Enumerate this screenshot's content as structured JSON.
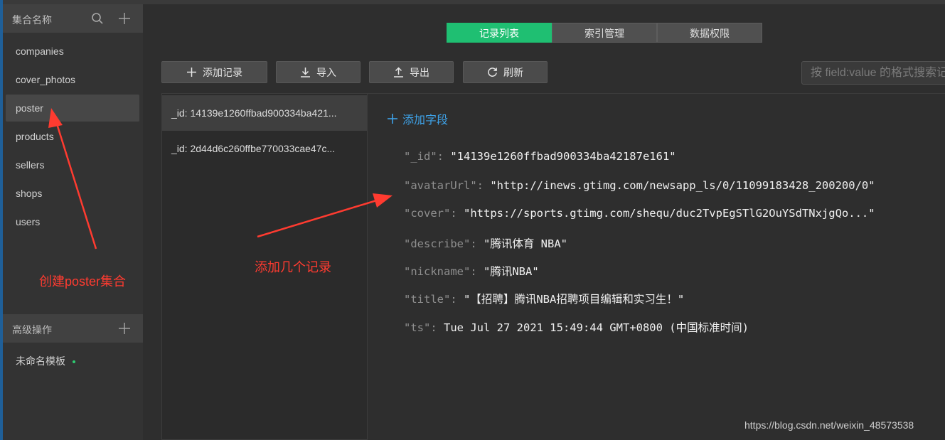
{
  "sidebar": {
    "title": "集合名称",
    "collections": [
      {
        "label": "companies"
      },
      {
        "label": "cover_photos"
      },
      {
        "label": "poster"
      },
      {
        "label": "products"
      },
      {
        "label": "sellers"
      },
      {
        "label": "shops"
      },
      {
        "label": "users"
      }
    ],
    "active_collection": "poster",
    "advanced_title": "高级操作",
    "template_label": "未命名模板"
  },
  "tabs": [
    {
      "label": "记录列表",
      "active": true
    },
    {
      "label": "索引管理",
      "active": false
    },
    {
      "label": "数据权限",
      "active": false
    }
  ],
  "toolbar": {
    "add_label": "添加记录",
    "import_label": "导入",
    "export_label": "导出",
    "refresh_label": "刷新",
    "search_placeholder": "按 field:value 的格式搜索记"
  },
  "records": [
    {
      "label": "_id: 14139e1260ffbad900334ba421..."
    },
    {
      "label": "_id: 2d44d6c260ffbe770033cae47c..."
    }
  ],
  "detail": {
    "add_field_label": "添加字段",
    "fields": [
      {
        "key": "\"_id\"",
        "value": "\"14139e1260ffbad900334ba42187e161\""
      },
      {
        "key": "\"avatarUrl\"",
        "value": "\"http://inews.gtimg.com/newsapp_ls/0/11099183428_200200/0\""
      },
      {
        "key": "\"cover\"",
        "value": "\"https://sports.gtimg.com/shequ/duc2TvpEgSTlG2OuYSdTNxjgQo...\""
      },
      {
        "key": "\"describe\"",
        "value": "\"腾讯体育 NBA\""
      },
      {
        "key": "\"nickname\"",
        "value": "\"腾讯NBA\""
      },
      {
        "key": "\"title\"",
        "value": "\"【招聘】腾讯NBA招聘项目编辑和实习生！\""
      },
      {
        "key": "\"ts\"",
        "value": "Tue Jul 27 2021 15:49:44 GMT+0800 (中国标准时间)"
      }
    ]
  },
  "annotations": {
    "create_collection": "创建poster集合",
    "add_records": "添加几个记录"
  },
  "watermark": "https://blog.csdn.net/weixin_48573538",
  "colors": {
    "accent_green": "#1fbf72",
    "link_blue": "#3ea2e8",
    "annotation_red": "#ff3b30"
  }
}
